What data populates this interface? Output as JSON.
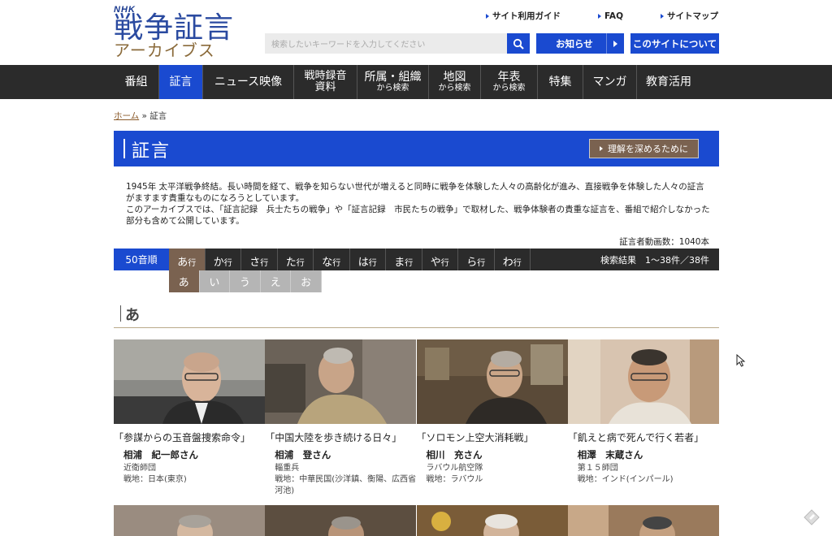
{
  "logo": {
    "nhk": "NHK",
    "title": "戦争証言",
    "subtitle": "アーカイブス"
  },
  "toplinks": [
    {
      "label": "サイト利用ガイド"
    },
    {
      "label": "FAQ"
    },
    {
      "label": "サイトマップ"
    }
  ],
  "search": {
    "placeholder": "検索したいキーワードを入力してください"
  },
  "buttons": {
    "notice": "お知らせ",
    "about": "このサイトについて",
    "deepen": "理解を深めるために"
  },
  "nav": [
    {
      "label": "番組"
    },
    {
      "label": "証言",
      "active": true
    },
    {
      "label": "ニュース映像"
    },
    {
      "label": "戦時録音",
      "label2": "資料"
    },
    {
      "label": "所属・組織",
      "small": "から検索"
    },
    {
      "label": "地図",
      "small": "から検索"
    },
    {
      "label": "年表",
      "small": "から検索"
    },
    {
      "label": "特集"
    },
    {
      "label": "マンガ"
    },
    {
      "label": "教育活用"
    }
  ],
  "breadcrumb": {
    "home": "ホーム",
    "sep": "»",
    "current": "証言"
  },
  "page_title": "証言",
  "intro": [
    "1945年 太平洋戦争終結。長い時間を経て、戦争を知らない世代が増えると同時に戦争を体験した人々の高齢化が進み、直接戦争を体験した人々の証言がますます貴重なものになろうとしています。",
    "このアーカイブスでは、「証言記録　兵士たちの戦争」や「証言記録　市民たちの戦争」で取材した、戦争体験者の貴重な証言を、番組で紹介しなかった部分も含めて公開しています。"
  ],
  "count": "証言者動画数：1040本",
  "kana": {
    "label": "50音順",
    "rows": [
      {
        "k": "あ",
        "s": "行",
        "active": true
      },
      {
        "k": "か",
        "s": "行"
      },
      {
        "k": "さ",
        "s": "行"
      },
      {
        "k": "た",
        "s": "行"
      },
      {
        "k": "な",
        "s": "行"
      },
      {
        "k": "は",
        "s": "行"
      },
      {
        "k": "ま",
        "s": "行"
      },
      {
        "k": "や",
        "s": "行"
      },
      {
        "k": "ら",
        "s": "行"
      },
      {
        "k": "わ",
        "s": "行"
      }
    ],
    "result": "検索結果　1～38件／38件",
    "sub": [
      {
        "k": "あ",
        "active": true
      },
      {
        "k": "い"
      },
      {
        "k": "う"
      },
      {
        "k": "え"
      },
      {
        "k": "お"
      }
    ]
  },
  "section_title": "あ",
  "cards": [
    {
      "quote": "「参謀からの玉音盤捜索命令」",
      "name": "相浦　紀一郎さん",
      "unit": "近衛師団",
      "place": "戦地：日本(東京)"
    },
    {
      "quote": "「中国大陸を歩き続ける日々」",
      "name": "相浦　登さん",
      "unit": "輜重兵",
      "place": "戦地：中華民国(沙洋鎮、衡陽、広西省河池)"
    },
    {
      "quote": "「ソロモン上空大消耗戦」",
      "name": "相川　充さん",
      "unit": "ラバウル航空隊",
      "place": "戦地：ラバウル"
    },
    {
      "quote": "「飢えと病で死んで行く若者」",
      "name": "相澤　末蔵さん",
      "unit": "第１５師団",
      "place": "戦地：インド(インパール)"
    }
  ],
  "colors": {
    "blue": "#1a4ad0",
    "nav": "#2b2b2b",
    "brown": "#7a6250"
  }
}
